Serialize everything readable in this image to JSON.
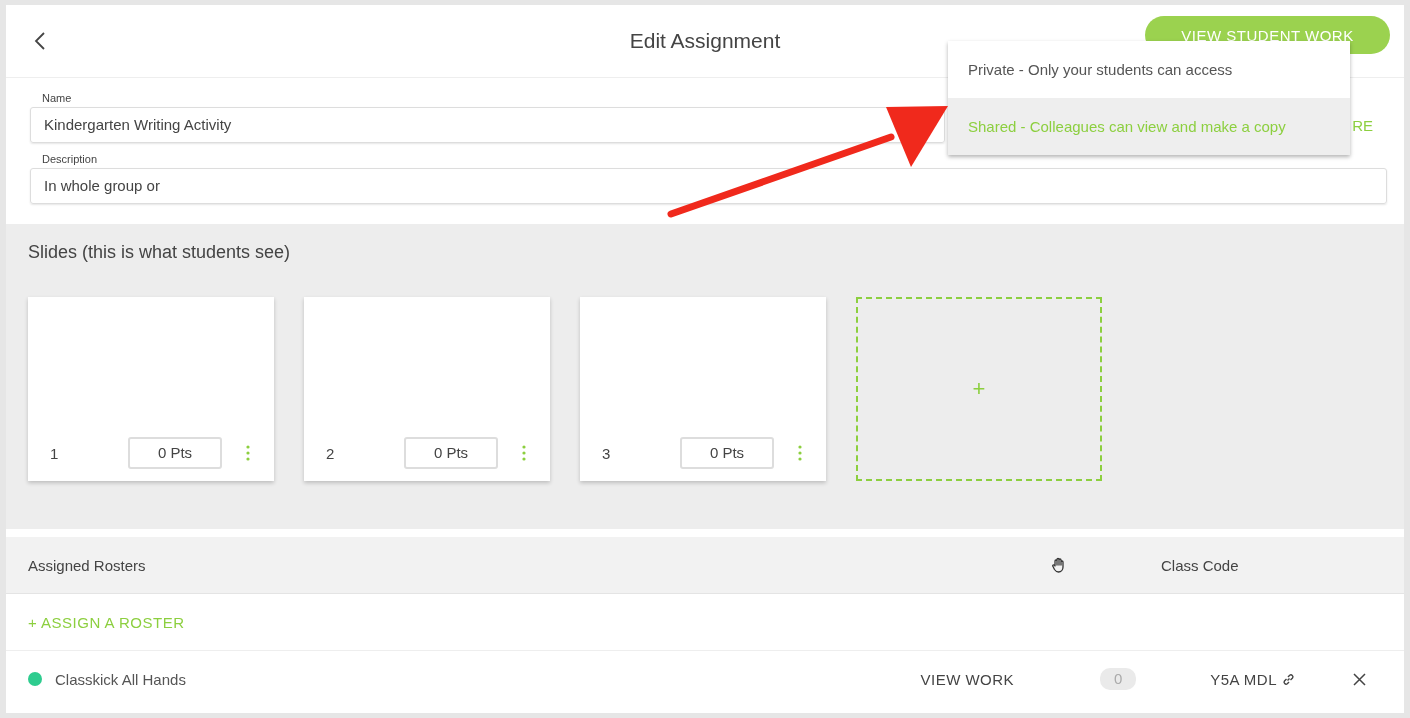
{
  "header": {
    "title": "Edit Assignment",
    "primary_button": "VIEW STUDENT WORK"
  },
  "visibility_menu": {
    "items": [
      {
        "label": "Private - Only your students can access",
        "selected": false
      },
      {
        "label": "Shared - Colleagues can view and make a copy",
        "selected": true
      }
    ]
  },
  "form": {
    "fields": [
      {
        "label": "Name",
        "value": "Kindergarten Writing Activity"
      },
      {
        "label": "Description",
        "value": "In whole group or"
      }
    ],
    "side_link": "RE"
  },
  "slides": {
    "title": "Slides (this is what students see)",
    "items": [
      {
        "number": "1",
        "points": "0 Pts"
      },
      {
        "number": "2",
        "points": "0 Pts"
      },
      {
        "number": "3",
        "points": "0 Pts"
      }
    ],
    "add_label": "+"
  },
  "rosters": {
    "columns": [
      "Assigned Rosters",
      "Class Code"
    ],
    "assign_link": "+ ASSIGN A ROSTER",
    "rows": [
      {
        "name": "Classkick All Hands",
        "color": "#2ecc8f",
        "action": "VIEW WORK",
        "count": "0",
        "code": "Y5A MDL"
      }
    ]
  }
}
